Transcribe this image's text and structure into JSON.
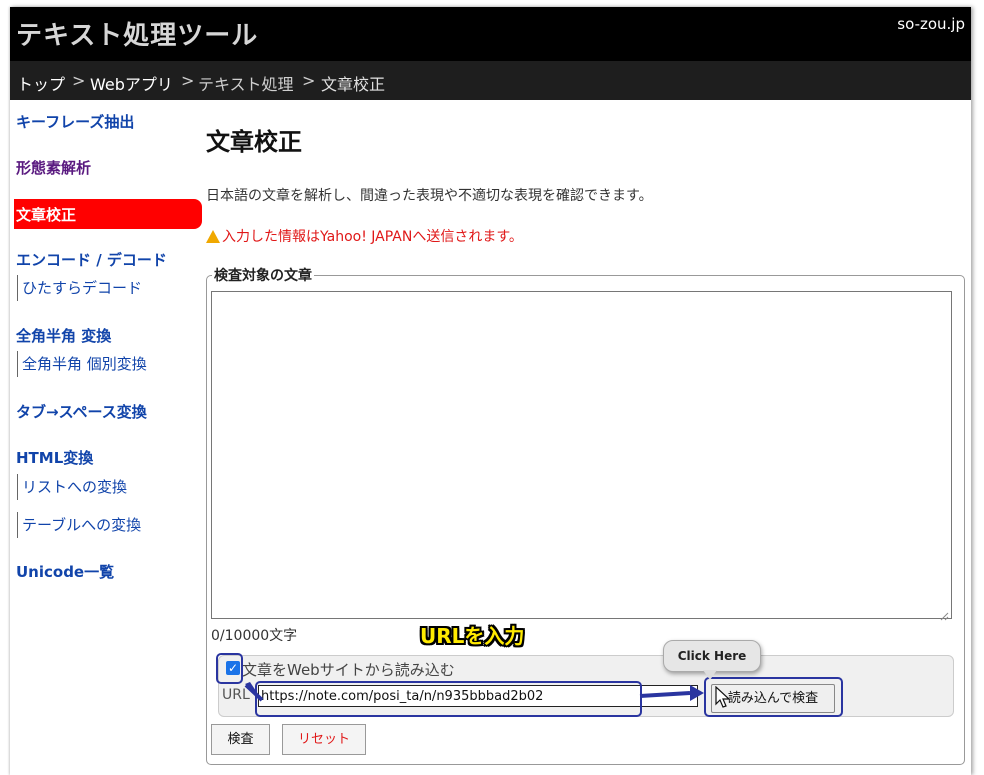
{
  "header": {
    "site_title": "テキスト処理ツール",
    "domain": "so-zou.jp"
  },
  "breadcrumb": {
    "items": [
      "トップ",
      "Webアプリ",
      "テキスト処理",
      "文章校正"
    ],
    "separator": ">"
  },
  "sidebar": {
    "items": [
      {
        "label": "キーフレーズ抽出"
      },
      {
        "label": "形態素解析"
      },
      {
        "label": "文章校正"
      },
      {
        "label": "エンコード / デコード"
      },
      {
        "label": "ひたすらデコード"
      },
      {
        "label": "全角半角 変換"
      },
      {
        "label": "全角半角 個別変換"
      },
      {
        "label": "タブ→スペース変換"
      },
      {
        "label": "HTML変換"
      },
      {
        "label": "リストへの変換"
      },
      {
        "label": "テーブルへの変換"
      },
      {
        "label": "Unicode一覧"
      }
    ]
  },
  "main": {
    "title": "文章校正",
    "description": "日本語の文章を解析し、間違った表現や不適切な表現を確認できます。",
    "warning": "入力した情報はYahoo! JAPANへ送信されます。",
    "form": {
      "legend": "検査対象の文章",
      "textarea_value": "",
      "counter": "0/10000文字",
      "web_checkbox_label": "文章をWebサイトから読み込む",
      "web_checkbox_checked": true,
      "url_label": "URL",
      "url_value": "https://note.com/posi_ta/n/n935bbbad2b02",
      "load_button": "読み込んで検査",
      "check_button": "検査",
      "reset_button": "リセット"
    }
  },
  "annotations": {
    "callout": "URLを入力",
    "tooltip": "Click Here",
    "color": "#2a35a0",
    "callout_color": "#ffea00"
  },
  "colors": {
    "header_bg": "#000000",
    "breadcrumb_bg": "#1e1e1e",
    "active_bg": "#ff0000",
    "link": "#1144aa",
    "warning": "#e01818"
  }
}
